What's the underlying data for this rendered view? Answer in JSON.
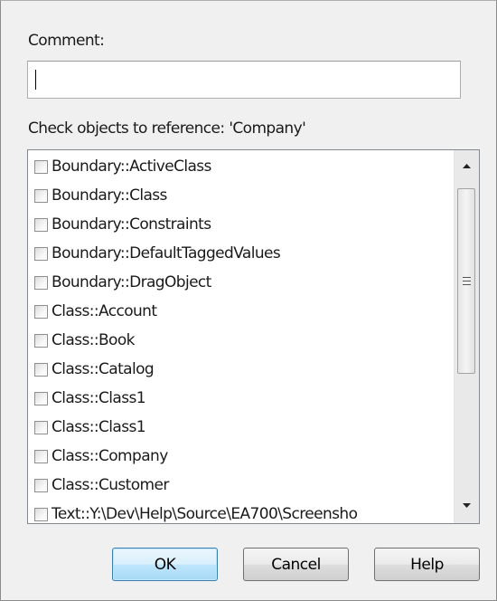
{
  "comment": {
    "label": "Comment:",
    "value": "",
    "placeholder": ""
  },
  "references": {
    "label": "Check objects to reference: 'Company'",
    "items": [
      {
        "label": "Boundary::ActiveClass",
        "checked": false
      },
      {
        "label": "Boundary::Class",
        "checked": false
      },
      {
        "label": "Boundary::Constraints",
        "checked": false
      },
      {
        "label": "Boundary::DefaultTaggedValues",
        "checked": false
      },
      {
        "label": "Boundary::DragObject",
        "checked": false
      },
      {
        "label": "Class::Account",
        "checked": false
      },
      {
        "label": "Class::Book",
        "checked": false
      },
      {
        "label": "Class::Catalog",
        "checked": false
      },
      {
        "label": "Class::Class1",
        "checked": false
      },
      {
        "label": "Class::Class1",
        "checked": false
      },
      {
        "label": "Class::Company",
        "checked": false
      },
      {
        "label": "Class::Customer",
        "checked": false
      },
      {
        "label": "Text::Y:\\Dev\\Help\\Source\\EA700\\Screensho",
        "checked": false
      }
    ],
    "scrollbar": {
      "up_icon": "scroll-up-arrow",
      "down_icon": "scroll-down-arrow"
    }
  },
  "buttons": {
    "ok": "OK",
    "cancel": "Cancel",
    "help": "Help"
  }
}
